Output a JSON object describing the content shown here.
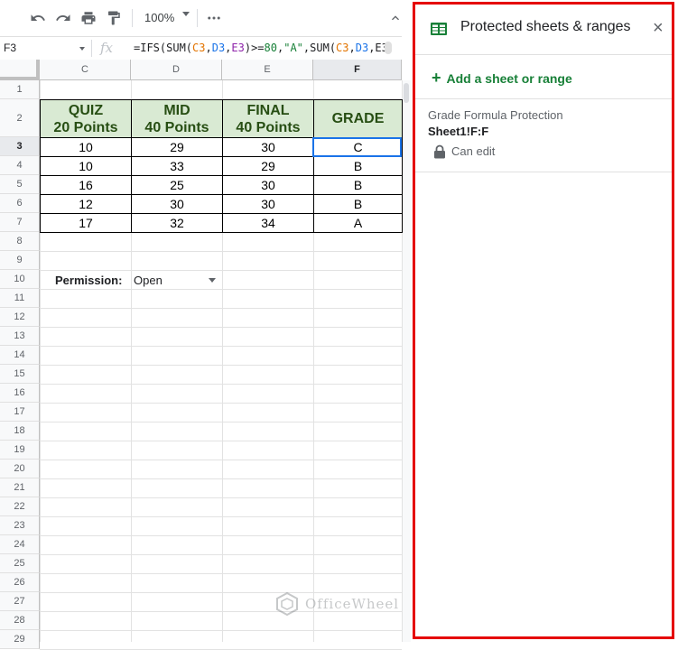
{
  "toolbar": {
    "zoom": "100%",
    "more": "⋮"
  },
  "formula_bar": {
    "cell_ref": "F3",
    "fx": "fx",
    "formula_parts": [
      {
        "t": "=IFS(SUM(",
        "c": ""
      },
      {
        "t": "C3",
        "c": "fc-o"
      },
      {
        "t": ",",
        "c": ""
      },
      {
        "t": "D3",
        "c": "fc-b"
      },
      {
        "t": ",",
        "c": ""
      },
      {
        "t": "E3",
        "c": "fc-p"
      },
      {
        "t": ")>=",
        "c": ""
      },
      {
        "t": "80",
        "c": "fc-g"
      },
      {
        "t": ",",
        "c": ""
      },
      {
        "t": "\"A\"",
        "c": "fc-g"
      },
      {
        "t": ",SUM(",
        "c": ""
      },
      {
        "t": "C3",
        "c": "fc-o"
      },
      {
        "t": ",",
        "c": ""
      },
      {
        "t": "D3",
        "c": "fc-b"
      },
      {
        "t": ",",
        "c": ""
      },
      {
        "t": "E3",
        "c": ""
      }
    ]
  },
  "columns": [
    "C",
    "D",
    "E",
    "F"
  ],
  "selected_column": "F",
  "rows": [
    "1",
    "2",
    "3",
    "4",
    "5",
    "6",
    "7",
    "8",
    "9",
    "10",
    "11",
    "12",
    "13",
    "14",
    "15",
    "16",
    "17",
    "18",
    "19",
    "20",
    "21",
    "22",
    "23",
    "24",
    "25",
    "26",
    "27",
    "28",
    "29"
  ],
  "selected_row": "3",
  "table": {
    "headers": [
      [
        "QUIZ",
        "20 Points"
      ],
      [
        "MID",
        "40 Points"
      ],
      [
        "FINAL",
        "40 Points"
      ],
      [
        "GRADE"
      ]
    ],
    "rows": [
      [
        "10",
        "29",
        "30",
        "C"
      ],
      [
        "10",
        "33",
        "29",
        "B"
      ],
      [
        "16",
        "25",
        "30",
        "B"
      ],
      [
        "12",
        "30",
        "30",
        "B"
      ],
      [
        "17",
        "32",
        "34",
        "A"
      ]
    ]
  },
  "permission": {
    "label": "Permission:",
    "value": "Open"
  },
  "watermark": "OfficeWheel",
  "panel": {
    "title": "Protected sheets & ranges",
    "close": "×",
    "add_label": "Add a sheet or range",
    "entry": {
      "description": "Grade Formula Protection",
      "range": "Sheet1!F:F",
      "permission": "Can edit"
    }
  },
  "colors": {
    "header_fill": "#d9ead3",
    "header_text": "#274e13",
    "panel_border": "#e50000",
    "accent_green": "#188038",
    "selection_blue": "#1a73e8"
  }
}
